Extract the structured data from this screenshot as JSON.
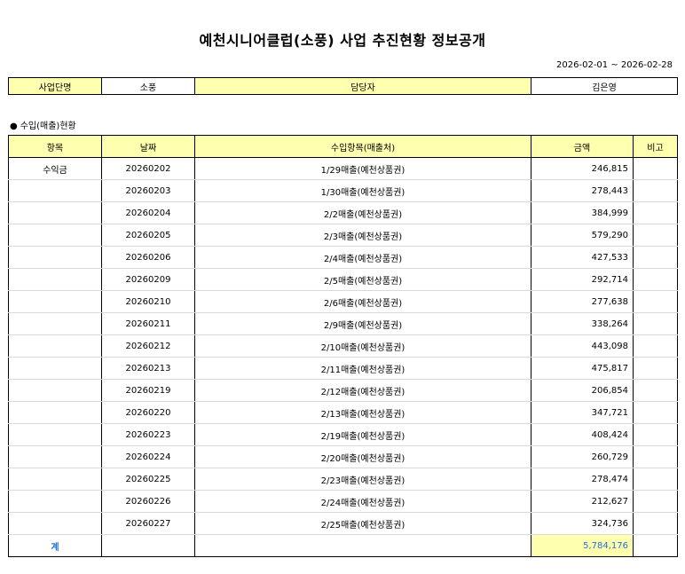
{
  "title": "예천시니어클럽(소풍) 사업 추진현황 정보공개",
  "period": "2026-02-01 ~ 2026-02-28",
  "info": {
    "business_label": "사업단명",
    "business_value": "소풍",
    "manager_label": "담당자",
    "manager_value": "김은영"
  },
  "section_title": "수입(매출)현황",
  "table": {
    "headers": [
      "항목",
      "날짜",
      "수입항목(매출처)",
      "금액",
      "비고"
    ],
    "rows": [
      {
        "item": "수익금",
        "date": "20260202",
        "desc": "1/29매출(예천상품권)",
        "amount": "246,815",
        "note": ""
      },
      {
        "item": "",
        "date": "20260203",
        "desc": "1/30매출(예천상품권)",
        "amount": "278,443",
        "note": ""
      },
      {
        "item": "",
        "date": "20260204",
        "desc": "2/2매출(예천상품권)",
        "amount": "384,999",
        "note": ""
      },
      {
        "item": "",
        "date": "20260205",
        "desc": "2/3매출(예천상품권)",
        "amount": "579,290",
        "note": ""
      },
      {
        "item": "",
        "date": "20260206",
        "desc": "2/4매출(예천상품권)",
        "amount": "427,533",
        "note": ""
      },
      {
        "item": "",
        "date": "20260209",
        "desc": "2/5매출(예천상품권)",
        "amount": "292,714",
        "note": ""
      },
      {
        "item": "",
        "date": "20260210",
        "desc": "2/6매출(예천상품권)",
        "amount": "277,638",
        "note": ""
      },
      {
        "item": "",
        "date": "20260211",
        "desc": "2/9매출(예천상품권)",
        "amount": "338,264",
        "note": ""
      },
      {
        "item": "",
        "date": "20260212",
        "desc": "2/10매출(예천상품권)",
        "amount": "443,098",
        "note": ""
      },
      {
        "item": "",
        "date": "20260213",
        "desc": "2/11매출(예천상품권)",
        "amount": "475,817",
        "note": ""
      },
      {
        "item": "",
        "date": "20260219",
        "desc": "2/12매출(예천상품권)",
        "amount": "206,854",
        "note": ""
      },
      {
        "item": "",
        "date": "20260220",
        "desc": "2/13매출(예천상품권)",
        "amount": "347,721",
        "note": ""
      },
      {
        "item": "",
        "date": "20260223",
        "desc": "2/19매출(예천상품권)",
        "amount": "408,424",
        "note": ""
      },
      {
        "item": "",
        "date": "20260224",
        "desc": "2/20매출(예천상품권)",
        "amount": "260,729",
        "note": ""
      },
      {
        "item": "",
        "date": "20260225",
        "desc": "2/23매출(예천상품권)",
        "amount": "278,474",
        "note": ""
      },
      {
        "item": "",
        "date": "20260226",
        "desc": "2/24매출(예천상품권)",
        "amount": "212,627",
        "note": ""
      },
      {
        "item": "",
        "date": "20260227",
        "desc": "2/25매출(예천상품권)",
        "amount": "324,736",
        "note": ""
      }
    ],
    "total_label": "계",
    "total_amount": "5,784,176"
  }
}
